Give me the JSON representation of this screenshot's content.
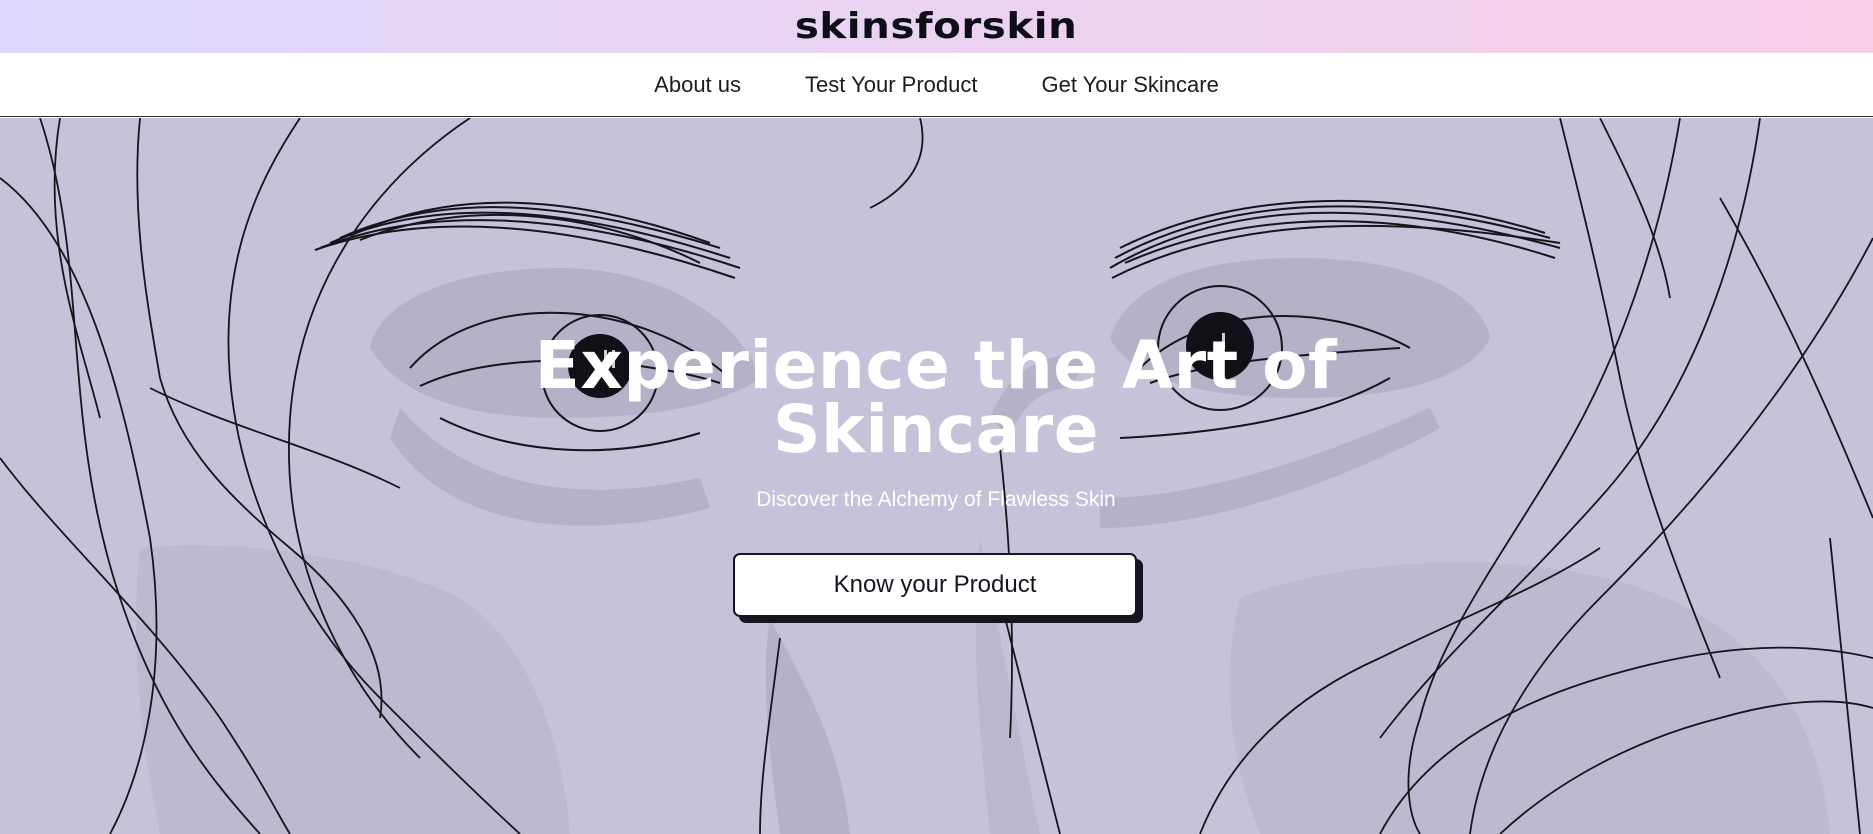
{
  "brand": {
    "name": "skinsforskin"
  },
  "nav": {
    "items": [
      {
        "label": "About us"
      },
      {
        "label": "Test Your Product"
      },
      {
        "label": "Get Your Skincare"
      }
    ]
  },
  "hero": {
    "title_line1": "Experience the Art of",
    "title_line2": "Skincare",
    "subtitle": "Discover the Alchemy of Flawless Skin",
    "cta_label": "Know your Product",
    "background_color": "#c5c2da",
    "illustration": "line-art-face-icon"
  },
  "colors": {
    "brand_gradient_start": "#dcd8fb",
    "brand_gradient_end": "#f6cfe6",
    "text_dark": "#161620",
    "hero_text": "#ffffff"
  }
}
